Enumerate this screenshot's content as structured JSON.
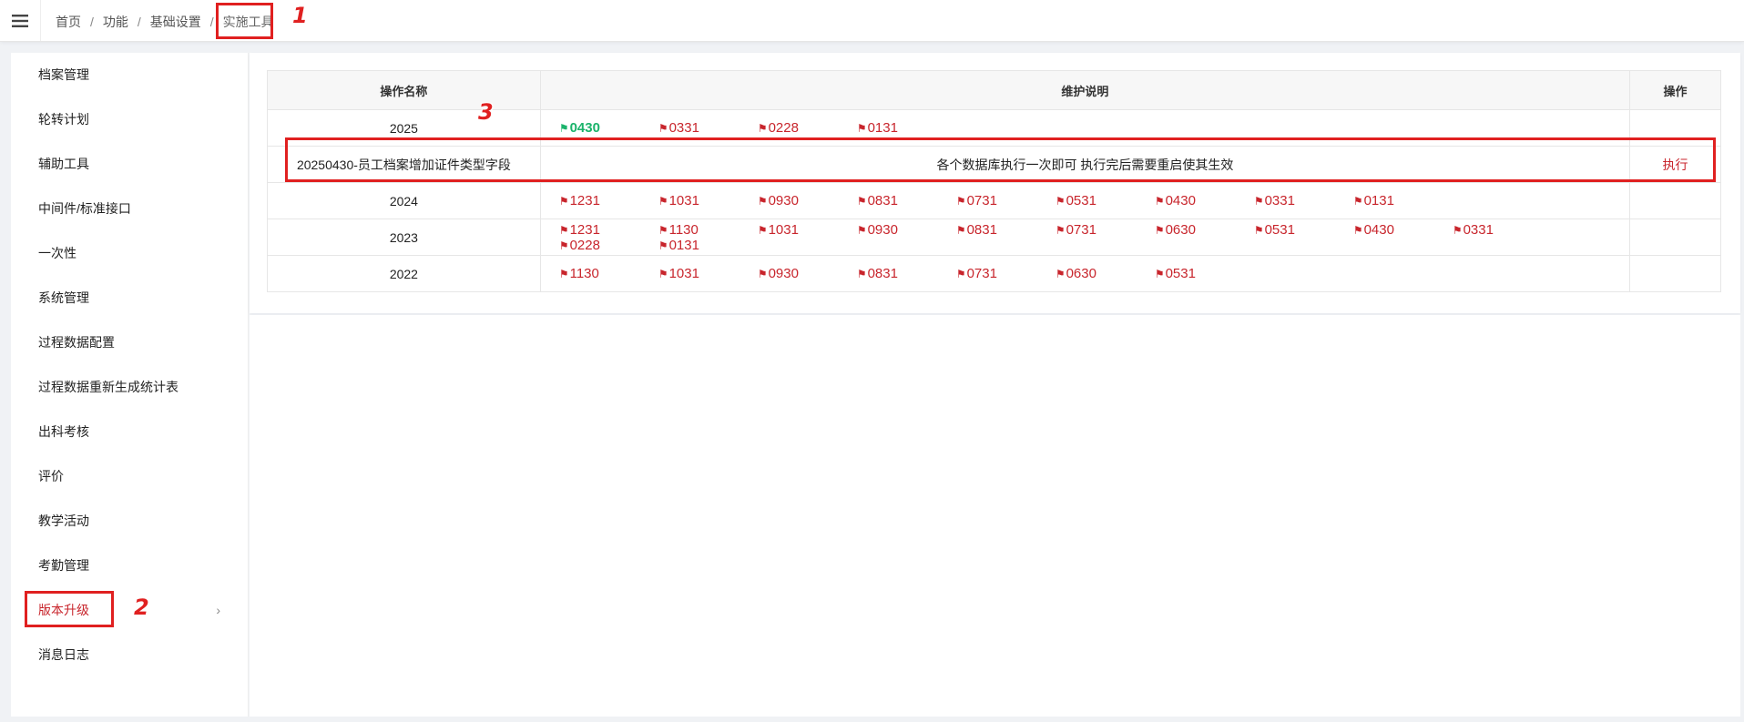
{
  "breadcrumb": [
    "首页",
    "功能",
    "基础设置",
    "实施工具"
  ],
  "sidebar": {
    "items": [
      {
        "label": "档案管理"
      },
      {
        "label": "轮转计划"
      },
      {
        "label": "辅助工具"
      },
      {
        "label": "中间件/标准接口"
      },
      {
        "label": "一次性"
      },
      {
        "label": "系统管理"
      },
      {
        "label": "过程数据配置"
      },
      {
        "label": "过程数据重新生成统计表"
      },
      {
        "label": "出科考核"
      },
      {
        "label": "评价"
      },
      {
        "label": "教学活动"
      },
      {
        "label": "考勤管理"
      },
      {
        "label": "版本升级",
        "active": true
      },
      {
        "label": "消息日志"
      }
    ],
    "chevron": "›"
  },
  "table": {
    "headers": [
      "操作名称",
      "维护说明",
      "操作"
    ],
    "rows": [
      {
        "name": "2025",
        "flags": [
          "0430",
          "0331",
          "0228",
          "0131"
        ],
        "active_flag": "0430"
      },
      {
        "name": "20250430-员工档案增加证件类型字段",
        "desc": "各个数据库执行一次即可 执行完后需要重启使其生效",
        "action": "执行"
      },
      {
        "name": "2024",
        "flags": [
          "1231",
          "1031",
          "0930",
          "0831",
          "0731",
          "0531",
          "0430",
          "0331",
          "0131"
        ]
      },
      {
        "name": "2023",
        "flags": [
          "1231",
          "1130",
          "1031",
          "0930",
          "0831",
          "0731",
          "0630",
          "0531",
          "0430",
          "0331",
          "0228",
          "0131"
        ]
      },
      {
        "name": "2022",
        "flags": [
          "1130",
          "1031",
          "0930",
          "0831",
          "0731",
          "0630",
          "0531"
        ]
      }
    ]
  },
  "callouts": [
    "1",
    "2",
    "3"
  ],
  "colors": {
    "accent": "#c8252c",
    "active_flag": "#1bb36b",
    "callout": "#e02020"
  },
  "icons": {
    "menu": "hamburger-icon",
    "flag": "flag-icon",
    "chevron": "chevron-right-icon"
  }
}
